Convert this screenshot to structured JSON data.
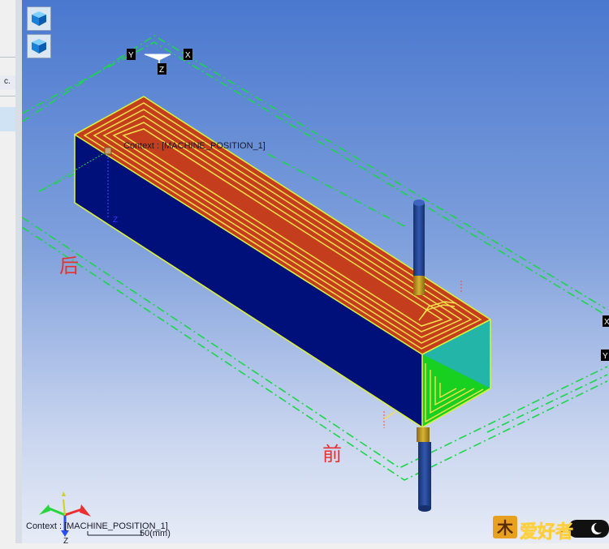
{
  "left_panel": {
    "tool_label": "c."
  },
  "toolbar": {
    "view_buttons": [
      {
        "icon": "iso-cube-icon"
      },
      {
        "icon": "iso-cube-icon"
      }
    ]
  },
  "viewport": {
    "top_axis": {
      "y": "Y",
      "x": "X",
      "z": "Z"
    },
    "context_label": "Context : [MACHINE_POSITION_1]",
    "side_axis": {
      "x": "X",
      "y": "Y"
    },
    "annotations": {
      "back": "后",
      "front": "前"
    },
    "bottom_triad": {
      "context_label": "Context : [MACHINE_POSITION_1]",
      "z": "Z",
      "scale": "50(mm)"
    },
    "watermark": {
      "text": "爱好者"
    }
  },
  "colors": {
    "top_face": "#c43d1c",
    "side_face": "#00107a",
    "end_face": "#22b5a8",
    "inner_face": "#18d020",
    "toolpath": "#f7e04a",
    "rod": "#213f8e",
    "frame": "#1cd64a"
  }
}
